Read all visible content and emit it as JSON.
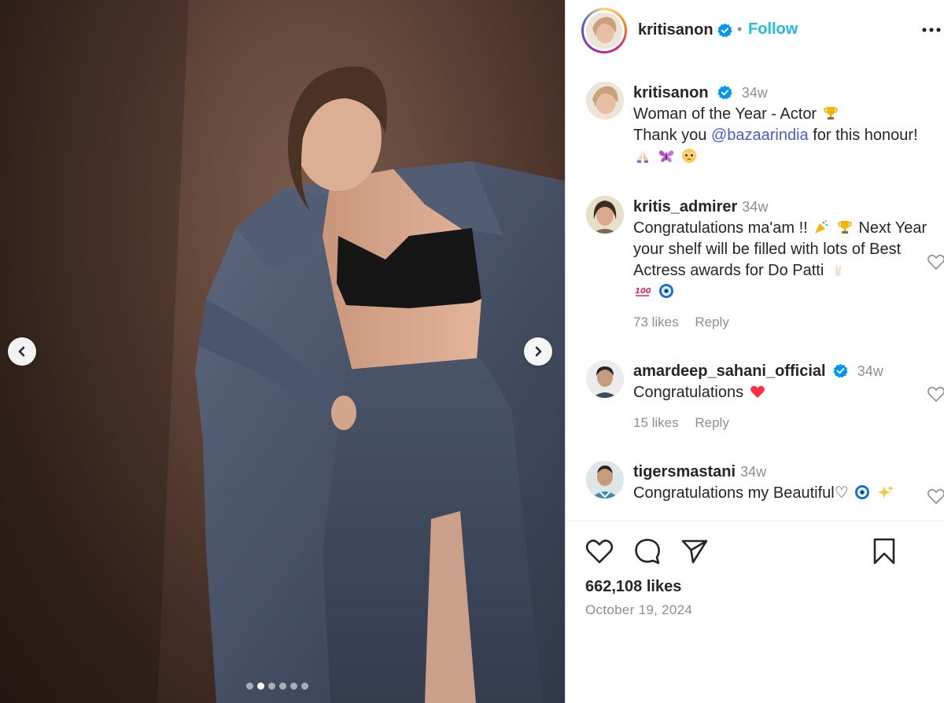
{
  "post": {
    "username": "kritisanon",
    "verified": true,
    "separator": "•",
    "follow_label": "Follow",
    "more_icon": "more-horizontal-icon",
    "carousel": {
      "slide_count": 6,
      "active_index": 1
    },
    "caption": {
      "username": "kritisanon",
      "time": "34w",
      "line1": "Woman of the Year - Actor",
      "line2_prefix": "Thank you",
      "mention": "@bazaarindia",
      "line2_suffix": "for this honour!",
      "emojis_line1": [
        "trophy-emoji"
      ],
      "emojis_line3": [
        "praying-hands-emoji",
        "butterfly-emoji",
        "pleading-face-emoji"
      ]
    },
    "comments": [
      {
        "username": "kritis_admirer",
        "time": "34w",
        "verified": false,
        "text_part1": "Congratulations ma'am !!",
        "text_part2": "Next Year your shelf will be filled with lots of Best Actress awards for Do Patti",
        "likes": "73 likes",
        "reply": "Reply"
      },
      {
        "username": "amardeep_sahani_official",
        "time": "34w",
        "verified": true,
        "text": "Congratulations",
        "likes": "15 likes",
        "reply": "Reply"
      },
      {
        "username": "tigersmastani",
        "time": "34w",
        "verified": false,
        "text": "Congratulations my Beautiful♡"
      }
    ],
    "likes_count": "662,108 likes",
    "date": "October 19, 2024"
  },
  "colors": {
    "follow_blue": "#1ebfd9",
    "mention_blue": "#4a5bd9",
    "verified_blue": "#0095f6",
    "secondary_gray": "#8e8e8e",
    "heart_red": "#ff3040"
  }
}
